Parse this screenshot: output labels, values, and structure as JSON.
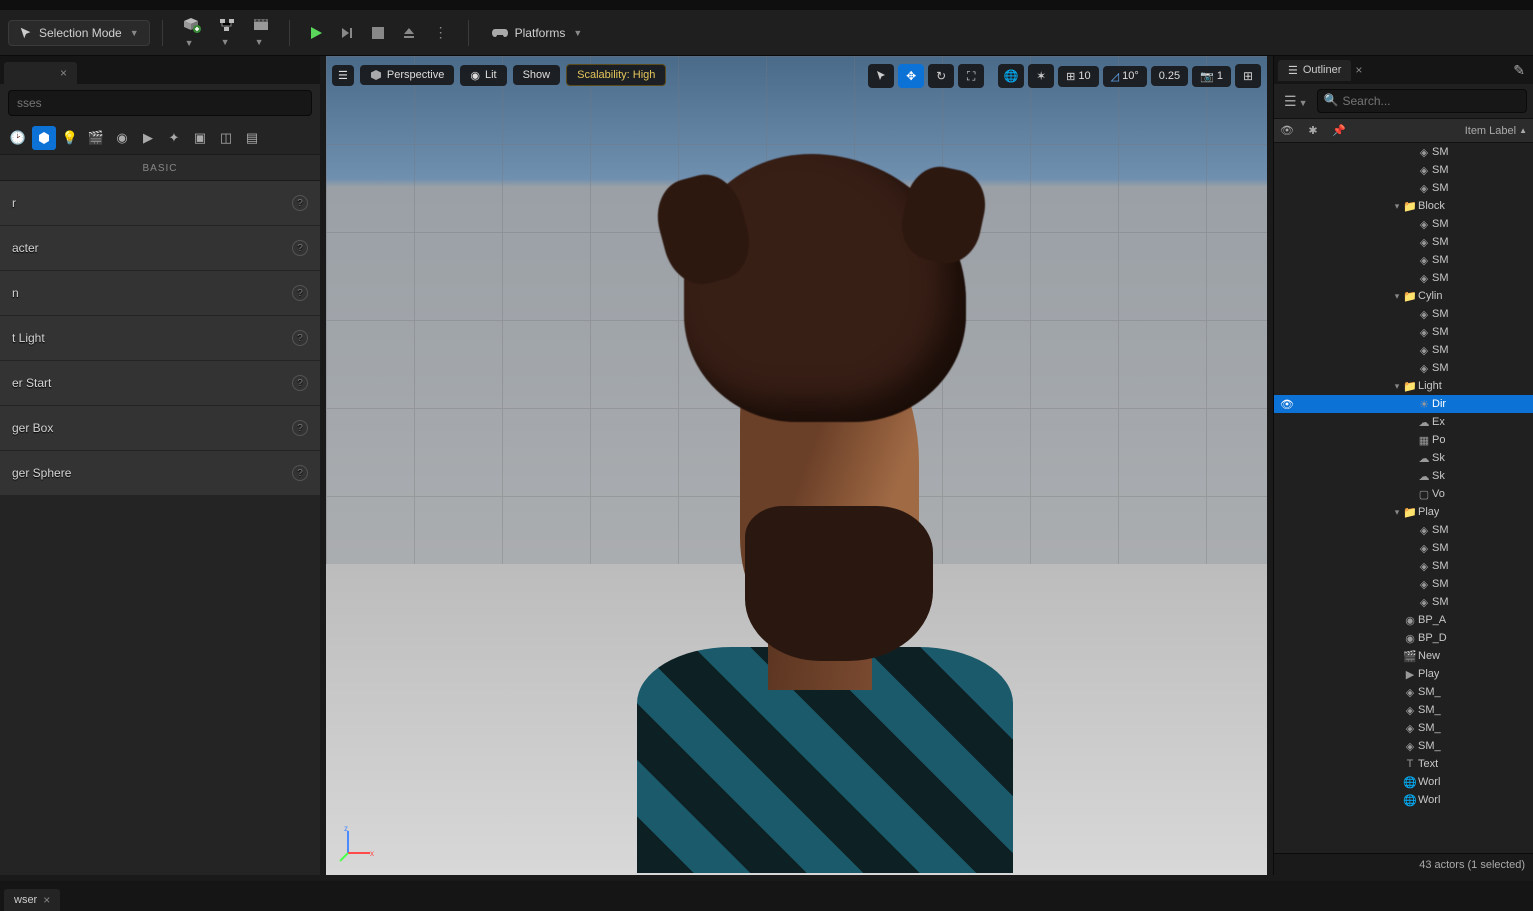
{
  "toolbar": {
    "mode_label": "Selection Mode",
    "platforms_label": "Platforms"
  },
  "left_panel": {
    "tab_close": "×",
    "search_placeholder": "sses",
    "section_header": "BASIC",
    "items": [
      {
        "label": "r"
      },
      {
        "label": "acter"
      },
      {
        "label": "n"
      },
      {
        "label": "t Light"
      },
      {
        "label": "er Start"
      },
      {
        "label": "ger Box"
      },
      {
        "label": "ger Sphere"
      }
    ]
  },
  "viewport": {
    "menu_perspective": "Perspective",
    "menu_lit": "Lit",
    "menu_show": "Show",
    "scalability": "Scalability: High",
    "grid_snap": "10",
    "angle_snap": "10°",
    "scale_snap": "0.25",
    "camera_speed": "1"
  },
  "outliner": {
    "title": "Outliner",
    "search_placeholder": "Search...",
    "header_label": "Item Label",
    "status": "43 actors (1 selected)",
    "tree": [
      {
        "depth": 4,
        "icon": "mesh",
        "label": "SM"
      },
      {
        "depth": 4,
        "icon": "mesh",
        "label": "SM"
      },
      {
        "depth": 4,
        "icon": "mesh",
        "label": "SM"
      },
      {
        "depth": 3,
        "icon": "folder",
        "label": "Block",
        "expander": "▾"
      },
      {
        "depth": 4,
        "icon": "mesh",
        "label": "SM"
      },
      {
        "depth": 4,
        "icon": "mesh",
        "label": "SM"
      },
      {
        "depth": 4,
        "icon": "mesh",
        "label": "SM"
      },
      {
        "depth": 4,
        "icon": "mesh",
        "label": "SM"
      },
      {
        "depth": 3,
        "icon": "folder",
        "label": "Cylin",
        "expander": "▾"
      },
      {
        "depth": 4,
        "icon": "mesh",
        "label": "SM"
      },
      {
        "depth": 4,
        "icon": "mesh",
        "label": "SM"
      },
      {
        "depth": 4,
        "icon": "mesh",
        "label": "SM"
      },
      {
        "depth": 4,
        "icon": "mesh",
        "label": "SM"
      },
      {
        "depth": 3,
        "icon": "folder",
        "label": "Light",
        "expander": "▾"
      },
      {
        "depth": 4,
        "icon": "light",
        "label": "Dir",
        "selected": true,
        "eye": true
      },
      {
        "depth": 4,
        "icon": "fog",
        "label": "Ex"
      },
      {
        "depth": 4,
        "icon": "post",
        "label": "Po"
      },
      {
        "depth": 4,
        "icon": "sky",
        "label": "Sk"
      },
      {
        "depth": 4,
        "icon": "sky",
        "label": "Sk"
      },
      {
        "depth": 4,
        "icon": "vol",
        "label": "Vo"
      },
      {
        "depth": 3,
        "icon": "folder",
        "label": "Play",
        "expander": "▾"
      },
      {
        "depth": 4,
        "icon": "mesh",
        "label": "SM"
      },
      {
        "depth": 4,
        "icon": "mesh",
        "label": "SM"
      },
      {
        "depth": 4,
        "icon": "mesh",
        "label": "SM"
      },
      {
        "depth": 4,
        "icon": "mesh",
        "label": "SM"
      },
      {
        "depth": 4,
        "icon": "mesh",
        "label": "SM"
      },
      {
        "depth": 3,
        "icon": "bp",
        "label": "BP_A"
      },
      {
        "depth": 3,
        "icon": "bp",
        "label": "BP_D"
      },
      {
        "depth": 3,
        "icon": "cine",
        "label": "New"
      },
      {
        "depth": 3,
        "icon": "player",
        "label": "Play"
      },
      {
        "depth": 3,
        "icon": "mesh",
        "label": "SM_"
      },
      {
        "depth": 3,
        "icon": "mesh",
        "label": "SM_"
      },
      {
        "depth": 3,
        "icon": "mesh",
        "label": "SM_"
      },
      {
        "depth": 3,
        "icon": "mesh",
        "label": "SM_"
      },
      {
        "depth": 3,
        "icon": "text",
        "label": "Text"
      },
      {
        "depth": 3,
        "icon": "world",
        "label": "Worl"
      },
      {
        "depth": 3,
        "icon": "world",
        "label": "Worl"
      }
    ]
  },
  "bottom": {
    "tab_label": "wser"
  }
}
